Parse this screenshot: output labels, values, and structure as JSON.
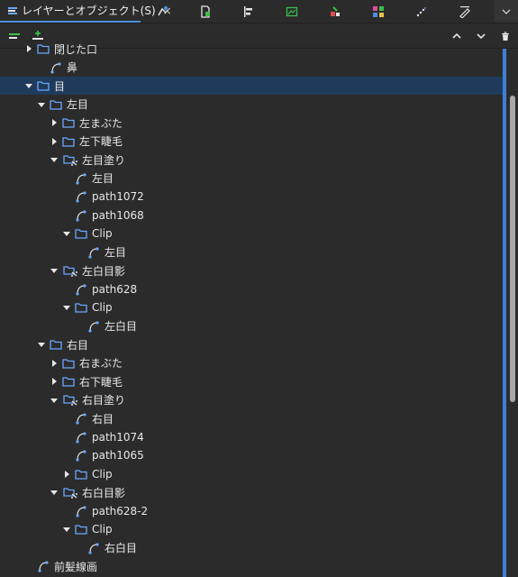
{
  "tab": {
    "label": "レイヤーとオブジェクト(S)",
    "close": "×"
  },
  "toolbar_icons": [
    "node-edit-icon",
    "document-icon",
    "align-icon",
    "image-icon",
    "path-effects-icon",
    "swatches-icon",
    "spray-icon",
    "pen-icon"
  ],
  "more_icon": "chevron-down-icon",
  "toolbar2": {
    "left_icons": [
      "layers-toggle-icon",
      "add-layer-icon"
    ],
    "right_icons": [
      "move-up-icon",
      "move-down-icon",
      "delete-icon"
    ]
  },
  "colors": {
    "selected": "#1f3b5b",
    "folder": "#6aa8ff",
    "accent": "#4d8fe0",
    "path": "#6aa8ff"
  },
  "tree": [
    {
      "label": "閉じた口",
      "level": 2,
      "type": "folder",
      "arrow": "right",
      "partial": true
    },
    {
      "label": "鼻",
      "level": 3,
      "type": "path",
      "arrow": "none"
    },
    {
      "label": "目",
      "level": 2,
      "type": "folder",
      "arrow": "down",
      "selected": true
    },
    {
      "label": "左目",
      "level": 3,
      "type": "folder",
      "arrow": "down"
    },
    {
      "label": "左まぶた",
      "level": 4,
      "type": "folder",
      "arrow": "right"
    },
    {
      "label": "左下睫毛",
      "level": 4,
      "type": "folder",
      "arrow": "right"
    },
    {
      "label": "左目塗り",
      "level": 4,
      "type": "clipgroup",
      "arrow": "down"
    },
    {
      "label": "左目",
      "level": 5,
      "type": "path",
      "arrow": "none"
    },
    {
      "label": "path1072",
      "level": 5,
      "type": "path",
      "arrow": "none"
    },
    {
      "label": "path1068",
      "level": 5,
      "type": "path",
      "arrow": "none"
    },
    {
      "label": "Clip",
      "level": 5,
      "type": "folder",
      "arrow": "down"
    },
    {
      "label": "左目",
      "level": 6,
      "type": "path",
      "arrow": "none"
    },
    {
      "label": "左白目影",
      "level": 4,
      "type": "clipgroup",
      "arrow": "down"
    },
    {
      "label": "path628",
      "level": 5,
      "type": "path",
      "arrow": "none"
    },
    {
      "label": "Clip",
      "level": 5,
      "type": "folder",
      "arrow": "down"
    },
    {
      "label": "左白目",
      "level": 6,
      "type": "path",
      "arrow": "none"
    },
    {
      "label": "右目",
      "level": 3,
      "type": "folder",
      "arrow": "down"
    },
    {
      "label": "右まぶた",
      "level": 4,
      "type": "folder",
      "arrow": "right"
    },
    {
      "label": "右下睫毛",
      "level": 4,
      "type": "folder",
      "arrow": "right"
    },
    {
      "label": "右目塗り",
      "level": 4,
      "type": "clipgroup",
      "arrow": "down"
    },
    {
      "label": "右目",
      "level": 5,
      "type": "path",
      "arrow": "none"
    },
    {
      "label": "path1074",
      "level": 5,
      "type": "path",
      "arrow": "none"
    },
    {
      "label": "path1065",
      "level": 5,
      "type": "path",
      "arrow": "none"
    },
    {
      "label": "Clip",
      "level": 5,
      "type": "folder",
      "arrow": "right"
    },
    {
      "label": "右白目影",
      "level": 4,
      "type": "clipgroup",
      "arrow": "down"
    },
    {
      "label": "path628-2",
      "level": 5,
      "type": "path",
      "arrow": "none"
    },
    {
      "label": "Clip",
      "level": 5,
      "type": "folder",
      "arrow": "down"
    },
    {
      "label": "右白目",
      "level": 6,
      "type": "path",
      "arrow": "none"
    },
    {
      "label": "前髪線画",
      "level": 2,
      "type": "path",
      "arrow": "none"
    }
  ]
}
